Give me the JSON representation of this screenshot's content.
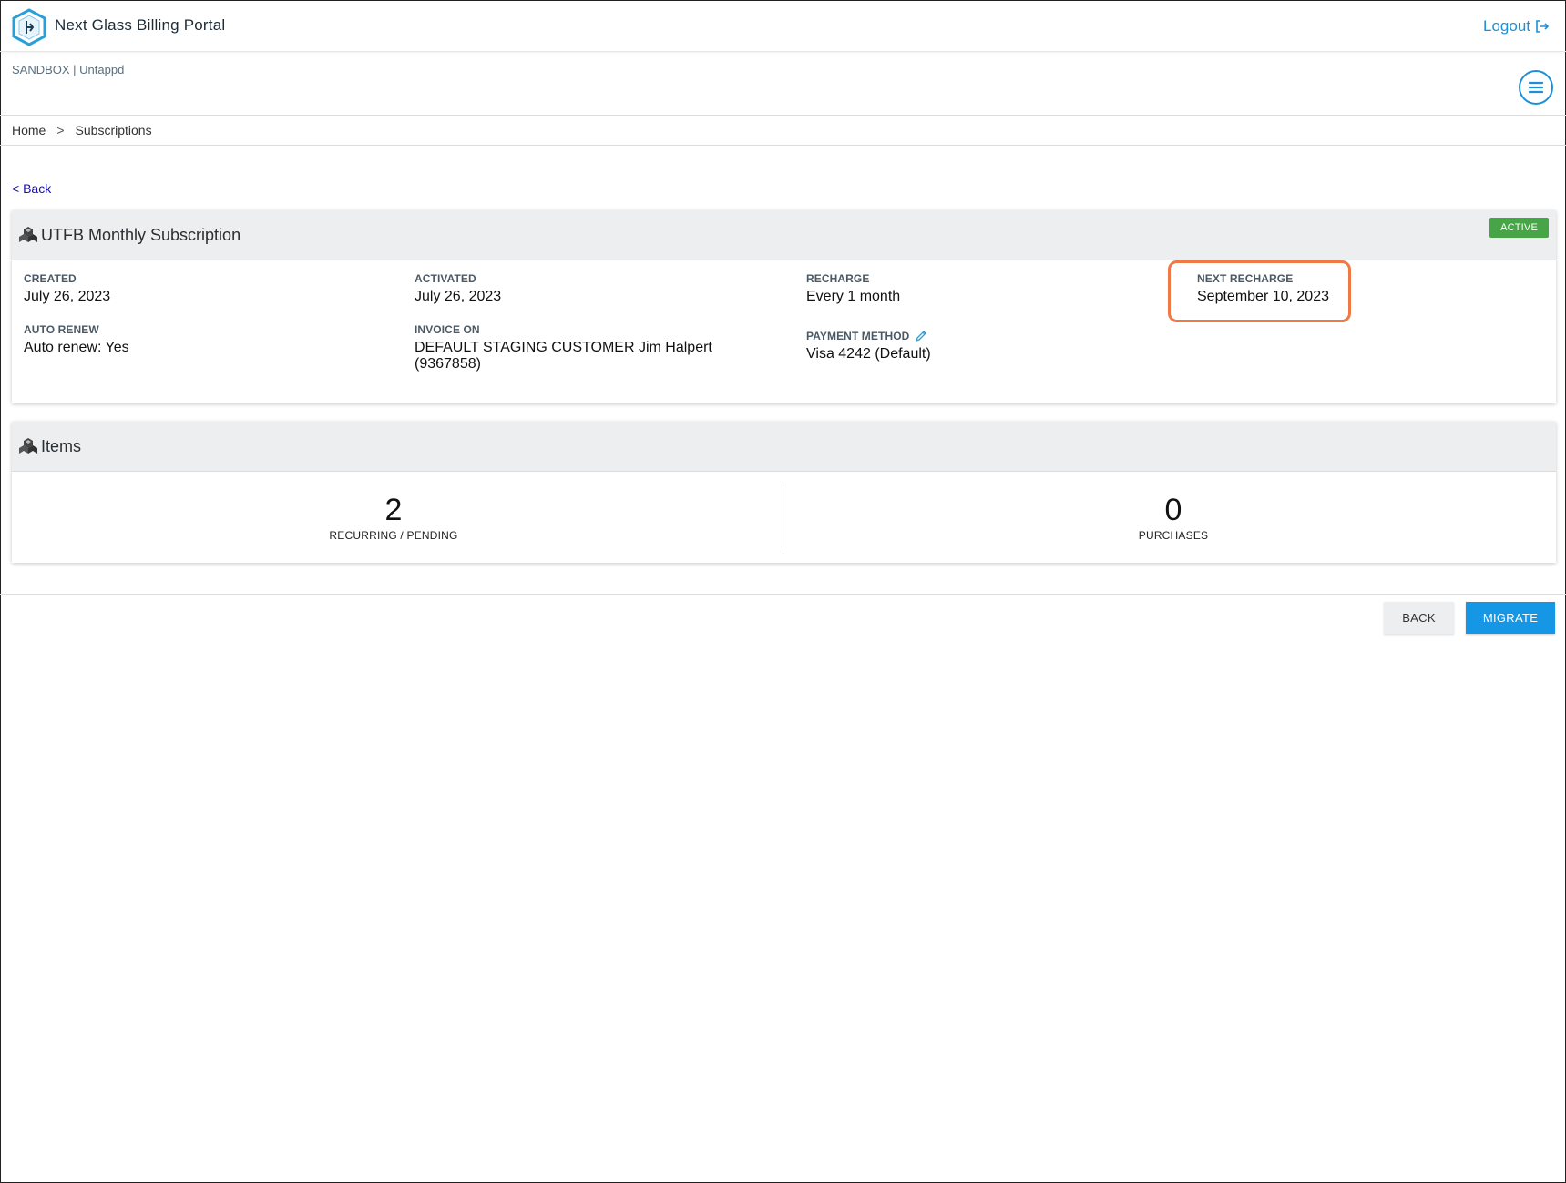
{
  "header": {
    "app_title": "Next Glass Billing Portal",
    "logout_label": "Logout"
  },
  "org_label": "SANDBOX | Untappd",
  "breadcrumb": {
    "items": [
      "Home",
      "Subscriptions"
    ],
    "separator": ">"
  },
  "back_link": "< Back",
  "subscription": {
    "title": "UTFB Monthly Subscription",
    "status": "ACTIVE",
    "fields": {
      "created": {
        "label": "CREATED",
        "value": "July 26, 2023"
      },
      "activated": {
        "label": "ACTIVATED",
        "value": "July 26, 2023"
      },
      "recharge": {
        "label": "RECHARGE",
        "value": "Every 1 month"
      },
      "next_recharge": {
        "label": "NEXT RECHARGE",
        "value": "September 10, 2023"
      },
      "auto_renew": {
        "label": "AUTO RENEW",
        "value": "Auto renew: Yes"
      },
      "invoice_on": {
        "label": "INVOICE ON",
        "value_line1": "DEFAULT STAGING CUSTOMER Jim Halpert",
        "value_line2": "(9367858)"
      },
      "payment_method": {
        "label": "PAYMENT METHOD",
        "value": "Visa 4242 (Default)"
      }
    }
  },
  "items": {
    "title": "Items",
    "recurring": {
      "count": "2",
      "label": "RECURRING / PENDING"
    },
    "purchases": {
      "count": "0",
      "label": "PURCHASES"
    }
  },
  "actions": {
    "back_label": "BACK",
    "migrate_label": "MIGRATE"
  },
  "colors": {
    "accent": "#1e8fd6",
    "active_badge": "#47a447",
    "highlight_outline": "#f07845",
    "migrate_button": "#1597e5"
  },
  "icons": [
    "logo-icon",
    "logout-icon",
    "menu-icon",
    "cubes-icon",
    "pencil-icon"
  ]
}
